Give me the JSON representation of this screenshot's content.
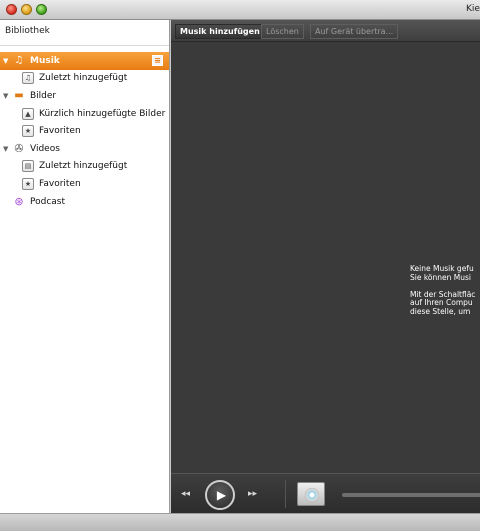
{
  "window": {
    "title": "Kie"
  },
  "sidebar": {
    "header": "Bibliothek",
    "items": [
      {
        "label": "Musik",
        "icon": "music-note-icon"
      },
      {
        "label": "Zuletzt hinzugefügt",
        "icon": "music-list-icon"
      },
      {
        "label": "Bilder",
        "icon": "pictures-folder-icon"
      },
      {
        "label": "Kürzlich hinzugefügte Bilder",
        "icon": "image-list-icon"
      },
      {
        "label": "Favoriten",
        "icon": "star-icon"
      },
      {
        "label": "Videos",
        "icon": "film-reel-icon"
      },
      {
        "label": "Zuletzt hinzugefügt",
        "icon": "video-list-icon"
      },
      {
        "label": "Favoriten",
        "icon": "star-icon"
      },
      {
        "label": "Podcast",
        "icon": "podcast-icon"
      }
    ]
  },
  "toolbar": {
    "add_music": "Musik hinzufügen",
    "delete": "Löschen",
    "transfer": "Auf Gerät übertra..."
  },
  "main": {
    "empty_line1": "Keine Musik gefu",
    "empty_line2": "Sie können Musi",
    "empty_line3": "Mit der Schaltfläc",
    "empty_line4": "auf Ihren Compu",
    "empty_line5": "diese Stelle, um"
  },
  "player": {
    "rewind": "◂◂",
    "forward": "▸▸",
    "play": "▶"
  },
  "colors": {
    "accent": "#ee8a1e",
    "main_bg": "#3a3a3a"
  }
}
